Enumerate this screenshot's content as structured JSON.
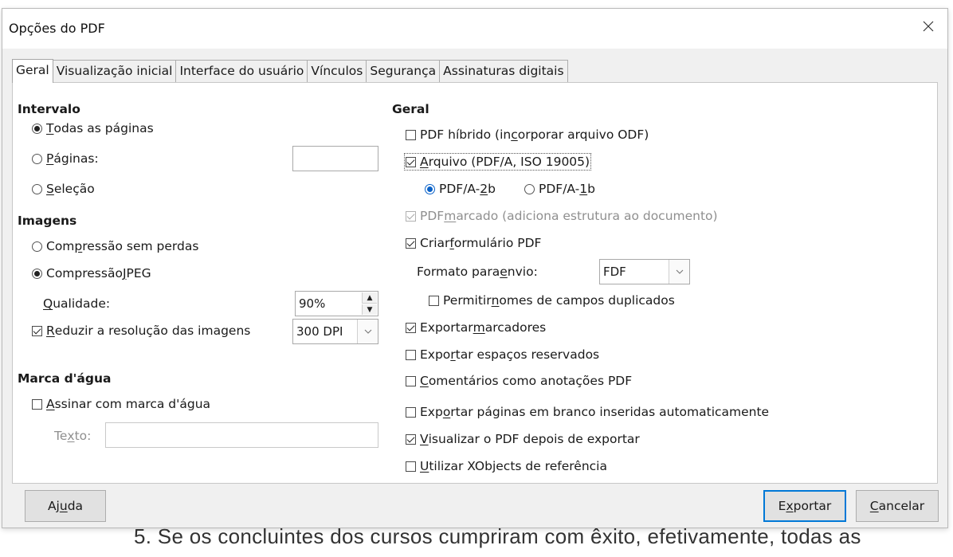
{
  "background_text": "5. Se os concluintes dos cursos cumpriram com êxito, efetivamente, todas as",
  "dialog": {
    "title": "Opções do PDF",
    "close_icon": "close-icon"
  },
  "tabs": [
    {
      "label": "Geral",
      "active": true
    },
    {
      "label": "Visualização inicial",
      "active": false
    },
    {
      "label": "Interface do usuário",
      "active": false
    },
    {
      "label": "Vínculos",
      "active": false
    },
    {
      "label": "Segurança",
      "active": false
    },
    {
      "label": "Assinaturas digitais",
      "active": false
    }
  ],
  "range": {
    "title": "Intervalo",
    "all_pages": {
      "pre": "",
      "ul": "T",
      "post": "odas as páginas",
      "selected": true
    },
    "pages": {
      "pre": "",
      "ul": "P",
      "post": "áginas:",
      "selected": false,
      "value": ""
    },
    "selection": {
      "pre": "",
      "ul": "S",
      "post": "eleção",
      "selected": false
    }
  },
  "images": {
    "title": "Imagens",
    "lossless": {
      "pre": "Com",
      "ul": "p",
      "post": "ressão sem perdas",
      "selected": false
    },
    "jpeg": {
      "pre": "Compressão ",
      "ul": "J",
      "post": "PEG",
      "selected": true
    },
    "quality": {
      "pre": "",
      "ul": "Q",
      "post": "ualidade:",
      "value": "90%"
    },
    "reduce": {
      "pre": "",
      "ul": "R",
      "post": "eduzir a resolução das imagens",
      "checked": true
    },
    "resolution": {
      "value": "300 DPI"
    }
  },
  "watermark": {
    "title": "Marca d'água",
    "sign": {
      "pre": "",
      "ul": "A",
      "post": "ssinar com marca d'água",
      "checked": false
    },
    "text": {
      "pre": "Te",
      "ul": "x",
      "post": "to:",
      "value": ""
    }
  },
  "general": {
    "title": "Geral",
    "hybrid": {
      "pre": "PDF híbrido (in",
      "ul": "c",
      "post": "orporar arquivo ODF)",
      "checked": false
    },
    "archive": {
      "pre": "",
      "ul": "A",
      "post": "rquivo (PDF/A, ISO 19005)",
      "checked": true
    },
    "pdfa2b": {
      "pre": "PDF/A-",
      "ul": "2",
      "post": "b",
      "selected": true
    },
    "pdfa1b": {
      "pre": "PDF/A-",
      "ul": "1",
      "post": "b",
      "selected": false
    },
    "tagged": {
      "pre": "PDF ",
      "ul": "m",
      "post": "arcado (adiciona estrutura ao documento)",
      "checked": true,
      "disabled": true
    },
    "form": {
      "pre": "Criar ",
      "ul": "f",
      "post": "ormulário PDF",
      "checked": true
    },
    "submit_format": {
      "pre": "Formato para ",
      "ul": "e",
      "post": "nvio:",
      "value": "FDF"
    },
    "dup_names": {
      "pre": "Permitir ",
      "ul": "n",
      "post": "omes de campos duplicados",
      "checked": false
    },
    "bookmarks": {
      "pre": "Exportar ",
      "ul": "m",
      "post": "arcadores",
      "checked": true
    },
    "placeholders": {
      "pre": "Expo",
      "ul": "r",
      "post": "tar espaços reservados",
      "checked": false
    },
    "comments": {
      "pre": "",
      "ul": "C",
      "post": "omentários como anotações PDF",
      "checked": false
    },
    "blank_pages": {
      "pre": "Exp",
      "ul": "o",
      "post": "rtar páginas em branco inseridas automaticamente",
      "checked": false
    },
    "view_after": {
      "pre": "",
      "ul": "V",
      "post": "isualizar o PDF depois de exportar",
      "checked": true
    },
    "xobjects": {
      "pre": "",
      "ul": "U",
      "post": "tilizar XObjects de referência",
      "checked": false
    }
  },
  "buttons": {
    "help": {
      "pre": "Aj",
      "ul": "u",
      "post": "da"
    },
    "export": {
      "pre": "E",
      "ul": "x",
      "post": "portar"
    },
    "cancel": {
      "pre": "",
      "ul": "C",
      "post": "ancelar"
    }
  },
  "colors": {
    "accent": "#0b62c8",
    "dialog_bg": "#f0f0f0",
    "panel_bg": "#ffffff"
  }
}
